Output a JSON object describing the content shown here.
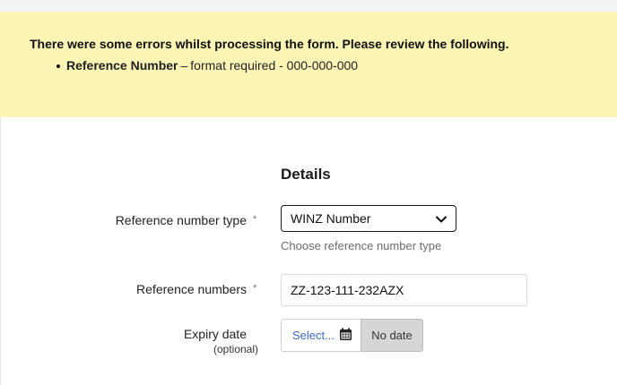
{
  "error_banner": {
    "title": "There were some errors whilst processing the form. Please review the following.",
    "items": [
      {
        "field": "Reference Number",
        "separator": "–",
        "message": "format required - 000-000-000"
      }
    ]
  },
  "section": {
    "title": "Details"
  },
  "fields": {
    "reference_type": {
      "label": "Reference number type",
      "required_mark": "*",
      "value": "WINZ Number",
      "hint": "Choose reference number type"
    },
    "reference_numbers": {
      "label": "Reference numbers",
      "required_mark": "*",
      "value": "ZZ-123-111-232AZX"
    },
    "expiry_date": {
      "label": "Expiry date",
      "optional_text": "(optional)",
      "select_label": "Select...",
      "no_date_label": "No date"
    }
  },
  "colors": {
    "error_background": "#fbf5b5",
    "link_blue": "#3c6cc4",
    "no_date_background": "#d6d6d6"
  },
  "icons": {
    "select_chevron": "chevron-down-icon",
    "date_picker": "calendar-icon",
    "bullet": "bullet-icon"
  }
}
